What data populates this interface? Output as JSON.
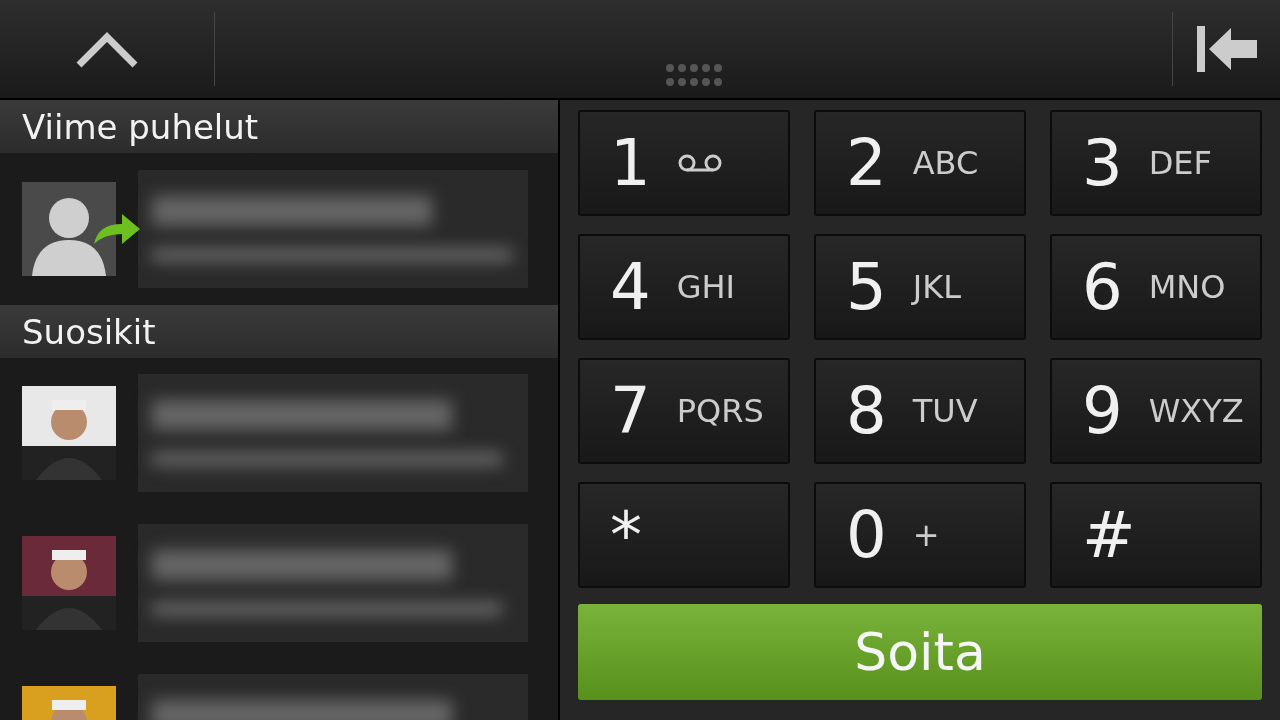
{
  "recent_calls": {
    "title": "Viime puhelut",
    "items": [
      {
        "kind": "default_avatar",
        "outgoing": true
      }
    ]
  },
  "favorites": {
    "title": "Suosikit"
  },
  "keypad": [
    {
      "digit": "1",
      "kind": "voicemail"
    },
    {
      "digit": "2",
      "letters": "ABC",
      "kind": "letters"
    },
    {
      "digit": "3",
      "letters": "DEF",
      "kind": "letters"
    },
    {
      "digit": "4",
      "letters": "GHI",
      "kind": "letters"
    },
    {
      "digit": "5",
      "letters": "JKL",
      "kind": "letters"
    },
    {
      "digit": "6",
      "letters": "MNO",
      "kind": "letters"
    },
    {
      "digit": "7",
      "letters": "PQRS",
      "kind": "letters"
    },
    {
      "digit": "8",
      "letters": "TUV",
      "kind": "letters"
    },
    {
      "digit": "9",
      "letters": "WXYZ",
      "kind": "letters"
    },
    {
      "digit": "*",
      "kind": "symbol"
    },
    {
      "digit": "0",
      "letters": "+",
      "kind": "letters"
    },
    {
      "digit": "#",
      "kind": "symbol"
    }
  ],
  "call_button": {
    "label": "Soita"
  }
}
